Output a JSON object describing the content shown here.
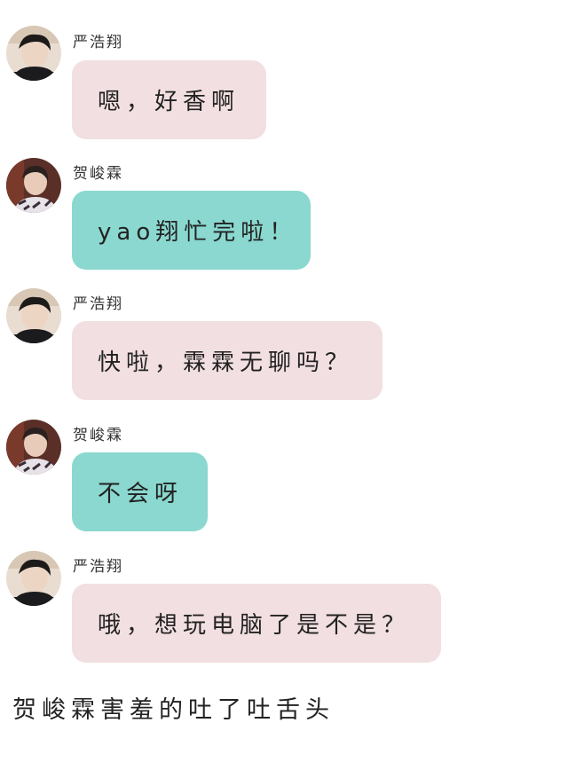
{
  "messages": [
    {
      "sender": "严浩翔",
      "text": "嗯，好香啊",
      "avatar_icon": "yanhaoxiang-avatar-icon",
      "bubble_color": "#f2dfe1"
    },
    {
      "sender": "贺峻霖",
      "text": "yao翔忙完啦！",
      "avatar_icon": "hejunlin-avatar-icon",
      "bubble_color": "#8ad8cf"
    },
    {
      "sender": "严浩翔",
      "text": "快啦，霖霖无聊吗？",
      "avatar_icon": "yanhaoxiang-avatar-icon",
      "bubble_color": "#f2dfe1"
    },
    {
      "sender": "贺峻霖",
      "text": "不会呀",
      "avatar_icon": "hejunlin-avatar-icon",
      "bubble_color": "#8ad8cf"
    },
    {
      "sender": "严浩翔",
      "text": "哦，想玩电脑了是不是？",
      "avatar_icon": "yanhaoxiang-avatar-icon",
      "bubble_color": "#f2dfe1"
    }
  ],
  "narration": "贺峻霖害羞的吐了吐舌头"
}
